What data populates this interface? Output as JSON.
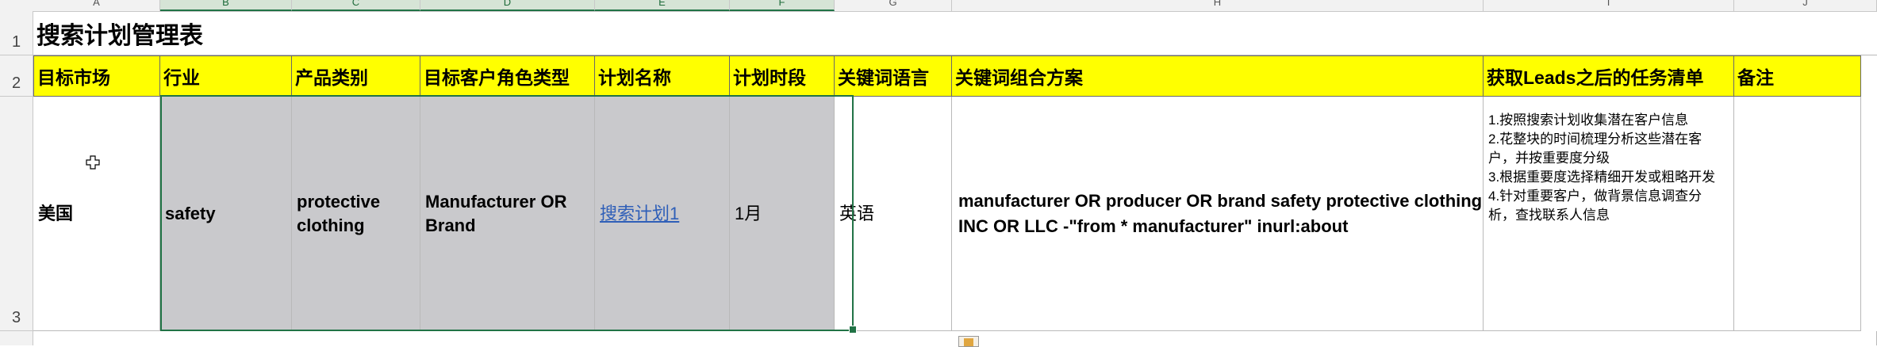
{
  "sheet": {
    "columns": [
      "A",
      "B",
      "C",
      "D",
      "E",
      "F",
      "G",
      "H",
      "I",
      "J"
    ],
    "rows": [
      "1",
      "2",
      "3"
    ],
    "title": "搜索计划管理表",
    "headers": {
      "market": "目标市场",
      "industry": "行业",
      "category": "产品类别",
      "customer_role": "目标客户角色类型",
      "plan_name": "计划名称",
      "period": "计划时段",
      "keyword_lang": "关键词语言",
      "keyword_scheme": "关键词组合方案",
      "task_list": "获取Leads之后的任务清单",
      "notes": "备注"
    },
    "row3": {
      "market": "美国",
      "industry": "safety",
      "category": "protective clothing",
      "customer_role": "Manufacturer OR Brand",
      "plan_name": "搜索计划1",
      "period": "1月",
      "keyword_lang": "英语",
      "keyword_scheme": "manufacturer OR producer OR brand safety protective clothing INC OR LLC -\"from * manufacturer\" inurl:about",
      "tasks": [
        "1.按照搜索计划收集潜在客户信息",
        "2.花整块的时间梳理分析这些潜在客户，并按重要度分级",
        "3.根据重要度选择精细开发或粗略开发",
        "4.针对重要客户，做背景信息调查分析，查找联系人信息"
      ],
      "notes": ""
    },
    "colors": {
      "header_fill": "#ffff00",
      "selection_fill": "#c9c9cc",
      "selection_border": "#217346",
      "link": "#2f5fb8"
    }
  }
}
